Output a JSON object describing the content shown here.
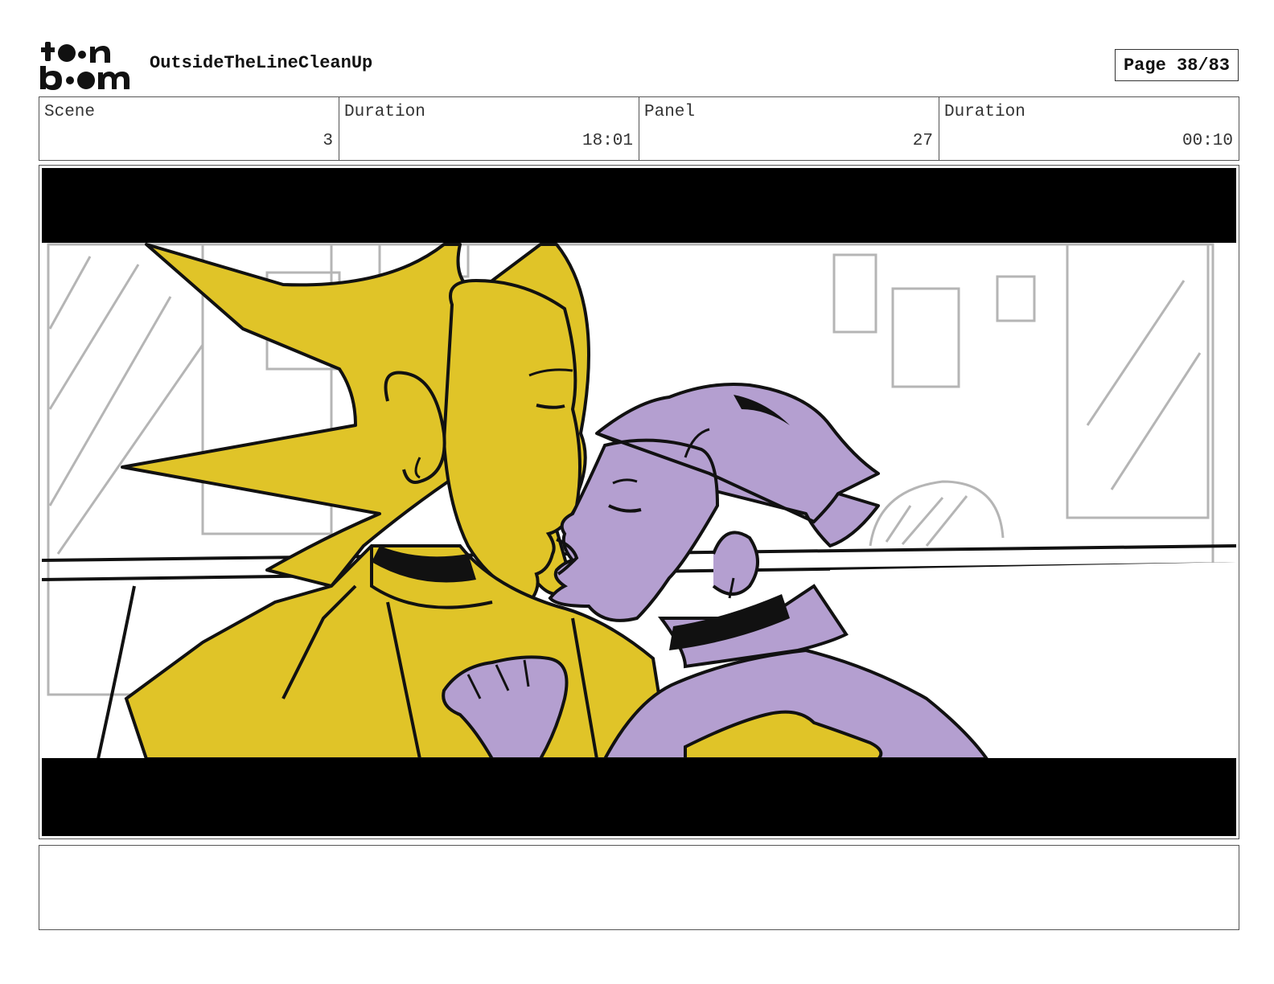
{
  "header": {
    "logo_alt": "toon boom",
    "project_title": "OutsideTheLineCleanUp",
    "page_label": "Page 38/83"
  },
  "info": {
    "scene_label": "Scene",
    "scene_value": "3",
    "scene_duration_label": "Duration",
    "scene_duration_value": "18:01",
    "panel_label": "Panel",
    "panel_value": "27",
    "panel_duration_label": "Duration",
    "panel_duration_value": "00:10"
  },
  "panel": {
    "image_description_icon": "storyboard-drawing",
    "colors": {
      "yellow_character": "#e0c428",
      "purple_character": "#b49fd0",
      "outline": "#111111",
      "letterbox": "#000000",
      "sketch": "#b5b5b5"
    }
  },
  "notes": {
    "text": ""
  }
}
